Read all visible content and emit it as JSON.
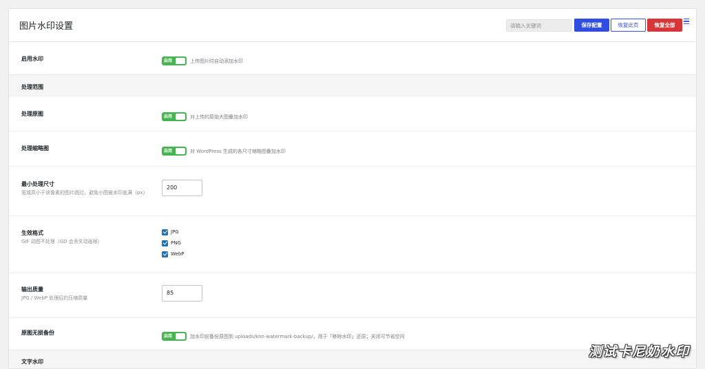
{
  "header": {
    "title": "图片水印设置",
    "search_placeholder": "请输入关键词",
    "save_label": "保存配置",
    "restore_page_label": "恢复此页",
    "restore_all_label": "恢复全部"
  },
  "rows": {
    "enable": {
      "label": "启用水印",
      "toggle": "启用",
      "hint": "上传图片时自动添加水印"
    },
    "scope_section": {
      "label": "处理范围"
    },
    "original": {
      "label": "处理原图",
      "toggle": "启用",
      "hint": "对上传的原始大图叠加水印"
    },
    "thumbs": {
      "label": "处理缩略图",
      "toggle": "启用",
      "hint": "对 WordPress 生成的各尺寸缩略图叠加水印"
    },
    "min_size": {
      "label": "最小处理尺寸",
      "desc": "宽或高小于该像素的图片跳过，避免小图被水印盖满（px）",
      "value": "200"
    },
    "formats": {
      "label": "生效格式",
      "desc": "GIF 动图不处理（GD 会丢失动画帧）",
      "options": [
        "JPG",
        "PNG",
        "WebP"
      ]
    },
    "quality": {
      "label": "输出质量",
      "desc": "JPG / WebP 处理后的压缩质量",
      "value": "85"
    },
    "backup": {
      "label": "原图无损备份",
      "toggle": "启用",
      "hint": "加水印前备份原图到 uploads/knn-watermark-backup/，用于「移除水印」还原；关闭可节省空间"
    },
    "text_section": {
      "label": "文字水印"
    }
  },
  "watermark_text": "测试卡尼奶水印",
  "colors": {
    "primary": "#2f4ee0",
    "danger": "#d63638",
    "toggle_on": "#46b450",
    "checkbox": "#2271b1"
  },
  "icons": [
    "menu-icon",
    "checkmark-icon"
  ]
}
